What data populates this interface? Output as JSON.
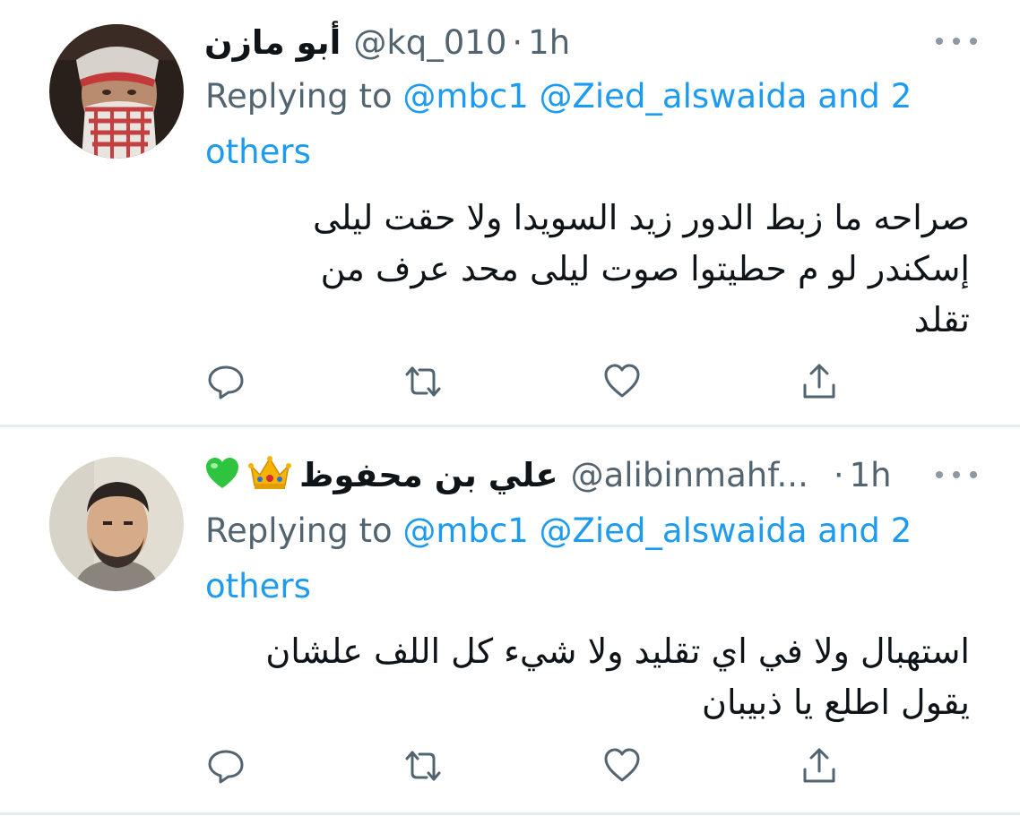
{
  "tweets": [
    {
      "display_name": "أبو مازن",
      "handle": "@kq_010",
      "separator": "·",
      "time": "1h",
      "replying_prefix": "Replying to",
      "replying_mentions": "@mbc1 @Zied_alswaida",
      "replying_and": "and",
      "replying_others": "2 others",
      "body_lines": [
        "صراحه ما زبط الدور زيد السويدا ولا حقت ليلى",
        "إسكندر لو م حطيتوا صوت ليلى محد عرف من",
        "تقلد"
      ]
    },
    {
      "display_name": "علي بن محفوظ",
      "handle": "@alibinmahf...",
      "separator": "·",
      "time": "1h",
      "replying_prefix": "Replying to",
      "replying_mentions": "@mbc1 @Zied_alswaida",
      "replying_and": "and",
      "replying_others": "2 others",
      "body_lines": [
        "استهبال ولا في اي تقليد ولا شيء كل اللف علشان",
        "يقول اطلع يا ذبيبان"
      ],
      "emojis": [
        "crown-emoji",
        "green-heart-emoji"
      ]
    }
  ],
  "icons": [
    "reply-icon",
    "retweet-icon",
    "like-icon",
    "share-icon",
    "more-icon"
  ],
  "colors": {
    "link": "#1d9bf0",
    "secondary_text": "#536471",
    "icon": "#536471",
    "divider": "#e6ecf0"
  }
}
